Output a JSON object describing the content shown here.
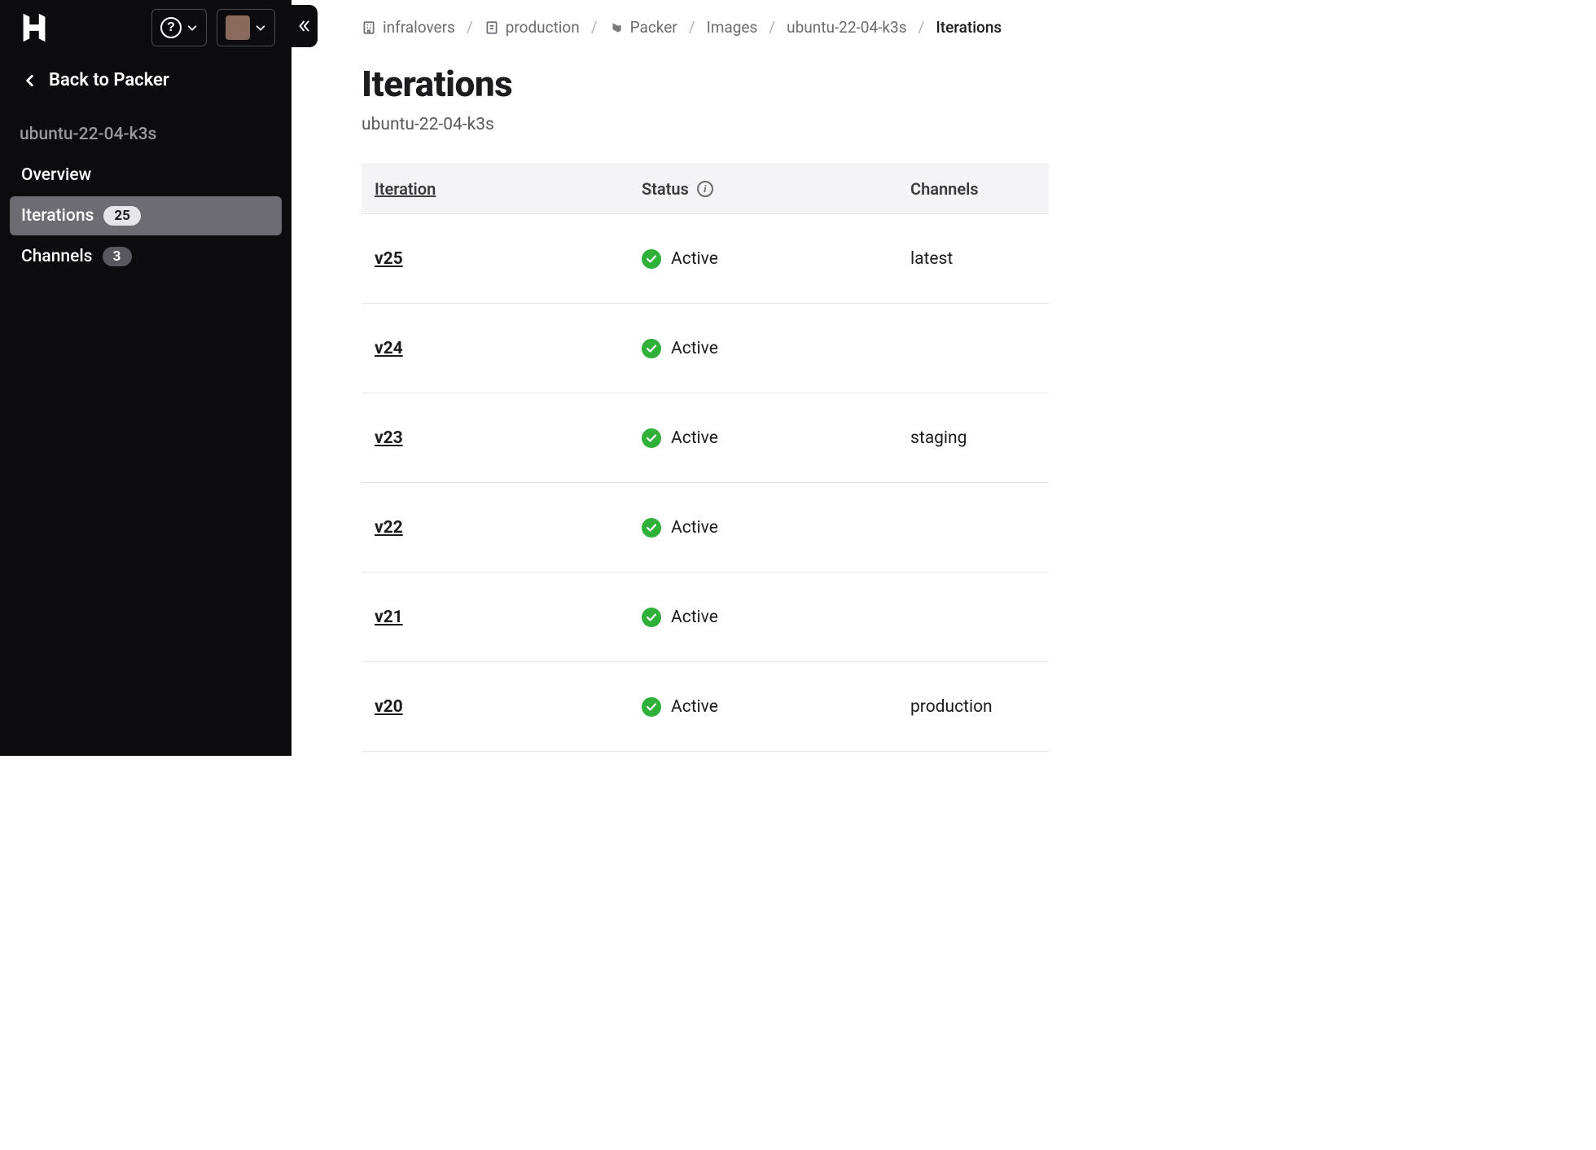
{
  "sidebar": {
    "back_label": "Back to Packer",
    "section_title": "ubuntu-22-04-k3s",
    "nav": [
      {
        "label": "Overview",
        "badge": null,
        "active": false
      },
      {
        "label": "Iterations",
        "badge": "25",
        "active": true
      },
      {
        "label": "Channels",
        "badge": "3",
        "active": false
      }
    ]
  },
  "breadcrumbs": [
    {
      "label": "infralovers",
      "icon": "org"
    },
    {
      "label": "production",
      "icon": "project"
    },
    {
      "label": "Packer",
      "icon": "packer"
    },
    {
      "label": "Images",
      "icon": null
    },
    {
      "label": "ubuntu-22-04-k3s",
      "icon": null
    },
    {
      "label": "Iterations",
      "icon": null,
      "current": true
    }
  ],
  "page": {
    "title": "Iterations",
    "subtitle": "ubuntu-22-04-k3s"
  },
  "table": {
    "columns": {
      "iteration": "Iteration",
      "status": "Status",
      "channels": "Channels"
    },
    "rows": [
      {
        "iteration": "v25",
        "status": "Active",
        "channels": "latest"
      },
      {
        "iteration": "v24",
        "status": "Active",
        "channels": ""
      },
      {
        "iteration": "v23",
        "status": "Active",
        "channels": "staging"
      },
      {
        "iteration": "v22",
        "status": "Active",
        "channels": ""
      },
      {
        "iteration": "v21",
        "status": "Active",
        "channels": ""
      },
      {
        "iteration": "v20",
        "status": "Active",
        "channels": "production"
      }
    ]
  }
}
